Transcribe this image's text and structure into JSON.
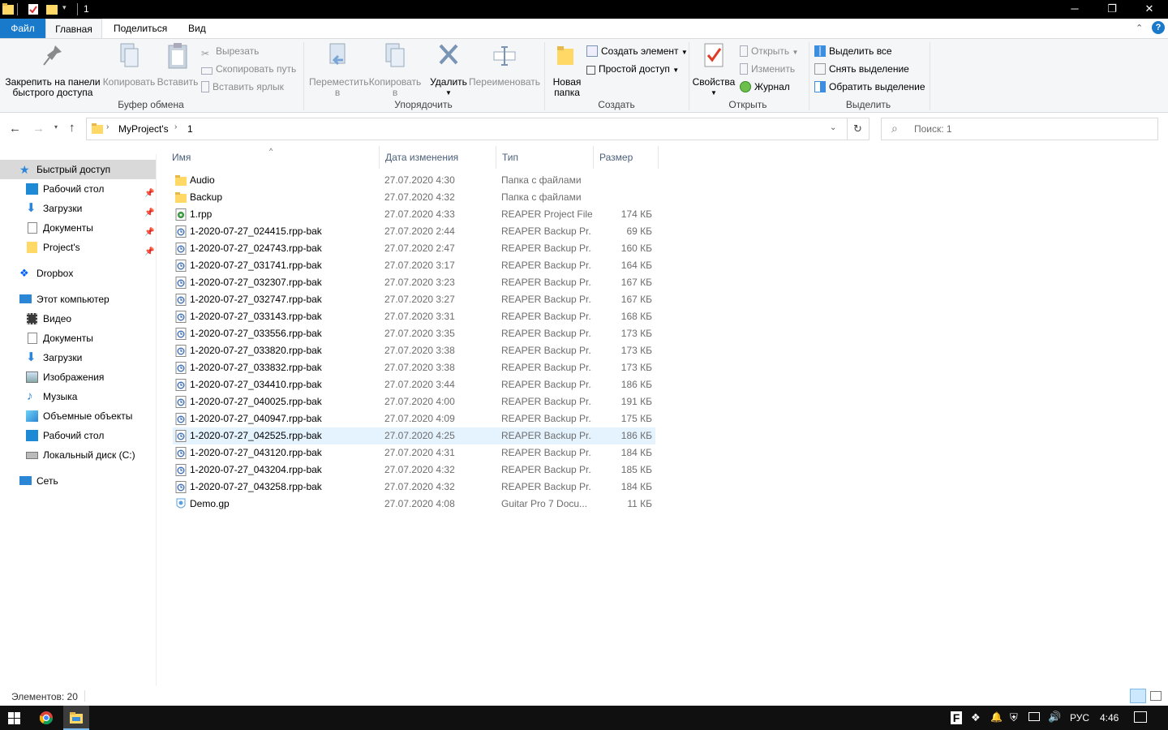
{
  "window": {
    "title": "1"
  },
  "tabs": {
    "file": "Файл",
    "home": "Главная",
    "share": "Поделиться",
    "view": "Вид"
  },
  "ribbon": {
    "pin": "Закрепить на панели быстрого доступа",
    "copy": "Копировать",
    "paste": "Вставить",
    "cut": "Вырезать",
    "copy_path": "Скопировать путь",
    "paste_shortcut": "Вставить ярлык",
    "clipboard_group": "Буфер обмена",
    "move_to": "Переместить в",
    "copy_to": "Копировать в",
    "delete": "Удалить",
    "rename": "Переименовать",
    "organize_group": "Упорядочить",
    "new_folder": "Новая папка",
    "new_item": "Создать элемент",
    "easy_access": "Простой доступ",
    "create_group": "Создать",
    "properties": "Свойства",
    "open": "Открыть",
    "edit": "Изменить",
    "history": "Журнал",
    "open_group": "Открыть",
    "select_all": "Выделить все",
    "select_none": "Снять выделение",
    "invert_selection": "Обратить выделение",
    "select_group": "Выделить"
  },
  "address": {
    "crumbs": [
      "MyProject's",
      "1"
    ],
    "search_placeholder": "Поиск: 1"
  },
  "nav": {
    "quick_access": "Быстрый доступ",
    "quick_items": [
      "Рабочий стол",
      "Загрузки",
      "Документы",
      "Project's"
    ],
    "dropbox": "Dropbox",
    "this_pc": "Этот компьютер",
    "pc_items": [
      "Видео",
      "Документы",
      "Загрузки",
      "Изображения",
      "Музыка",
      "Объемные объекты",
      "Рабочий стол",
      "Локальный диск (C:)"
    ],
    "network": "Сеть"
  },
  "columns": {
    "name": "Имя",
    "date": "Дата изменения",
    "type": "Тип",
    "size": "Размер"
  },
  "files": [
    {
      "name": "Audio",
      "date": "27.07.2020 4:30",
      "type": "Папка с файлами",
      "size": "",
      "kind": "folder"
    },
    {
      "name": "Backup",
      "date": "27.07.2020 4:32",
      "type": "Папка с файлами",
      "size": "",
      "kind": "folder"
    },
    {
      "name": "1.rpp",
      "date": "27.07.2020 4:33",
      "type": "REAPER Project File",
      "size": "174 КБ",
      "kind": "rpp"
    },
    {
      "name": "1-2020-07-27_024415.rpp-bak",
      "date": "27.07.2020 2:44",
      "type": "REAPER Backup Pr...",
      "size": "69 КБ",
      "kind": "bak"
    },
    {
      "name": "1-2020-07-27_024743.rpp-bak",
      "date": "27.07.2020 2:47",
      "type": "REAPER Backup Pr...",
      "size": "160 КБ",
      "kind": "bak"
    },
    {
      "name": "1-2020-07-27_031741.rpp-bak",
      "date": "27.07.2020 3:17",
      "type": "REAPER Backup Pr...",
      "size": "164 КБ",
      "kind": "bak"
    },
    {
      "name": "1-2020-07-27_032307.rpp-bak",
      "date": "27.07.2020 3:23",
      "type": "REAPER Backup Pr...",
      "size": "167 КБ",
      "kind": "bak"
    },
    {
      "name": "1-2020-07-27_032747.rpp-bak",
      "date": "27.07.2020 3:27",
      "type": "REAPER Backup Pr...",
      "size": "167 КБ",
      "kind": "bak"
    },
    {
      "name": "1-2020-07-27_033143.rpp-bak",
      "date": "27.07.2020 3:31",
      "type": "REAPER Backup Pr...",
      "size": "168 КБ",
      "kind": "bak"
    },
    {
      "name": "1-2020-07-27_033556.rpp-bak",
      "date": "27.07.2020 3:35",
      "type": "REAPER Backup Pr...",
      "size": "173 КБ",
      "kind": "bak"
    },
    {
      "name": "1-2020-07-27_033820.rpp-bak",
      "date": "27.07.2020 3:38",
      "type": "REAPER Backup Pr...",
      "size": "173 КБ",
      "kind": "bak"
    },
    {
      "name": "1-2020-07-27_033832.rpp-bak",
      "date": "27.07.2020 3:38",
      "type": "REAPER Backup Pr...",
      "size": "173 КБ",
      "kind": "bak"
    },
    {
      "name": "1-2020-07-27_034410.rpp-bak",
      "date": "27.07.2020 3:44",
      "type": "REAPER Backup Pr...",
      "size": "186 КБ",
      "kind": "bak"
    },
    {
      "name": "1-2020-07-27_040025.rpp-bak",
      "date": "27.07.2020 4:00",
      "type": "REAPER Backup Pr...",
      "size": "191 КБ",
      "kind": "bak"
    },
    {
      "name": "1-2020-07-27_040947.rpp-bak",
      "date": "27.07.2020 4:09",
      "type": "REAPER Backup Pr...",
      "size": "175 КБ",
      "kind": "bak"
    },
    {
      "name": "1-2020-07-27_042525.rpp-bak",
      "date": "27.07.2020 4:25",
      "type": "REAPER Backup Pr...",
      "size": "186 КБ",
      "kind": "bak",
      "selected": true
    },
    {
      "name": "1-2020-07-27_043120.rpp-bak",
      "date": "27.07.2020 4:31",
      "type": "REAPER Backup Pr...",
      "size": "184 КБ",
      "kind": "bak"
    },
    {
      "name": "1-2020-07-27_043204.rpp-bak",
      "date": "27.07.2020 4:32",
      "type": "REAPER Backup Pr...",
      "size": "185 КБ",
      "kind": "bak"
    },
    {
      "name": "1-2020-07-27_043258.rpp-bak",
      "date": "27.07.2020 4:32",
      "type": "REAPER Backup Pr...",
      "size": "184 КБ",
      "kind": "bak"
    },
    {
      "name": "Demo.gp",
      "date": "27.07.2020 4:08",
      "type": "Guitar Pro 7 Docu...",
      "size": "11 КБ",
      "kind": "gp"
    }
  ],
  "status": {
    "items_count": "Элементов: 20"
  },
  "taskbar": {
    "lang": "РУС",
    "time": "4:46"
  },
  "colors": {
    "accent": "#1979ca",
    "selection": "#e5f3ff",
    "folder": "#ffd866"
  }
}
